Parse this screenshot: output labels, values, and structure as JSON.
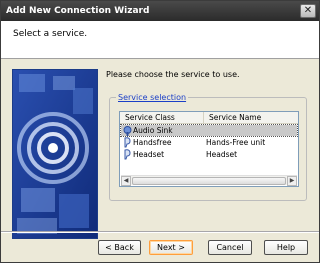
{
  "window": {
    "title": "Add New Connection Wizard"
  },
  "header": {
    "title": "Select a service."
  },
  "body": {
    "prompt": "Please choose the service to use."
  },
  "service_selection": {
    "label": "Service selection",
    "columns": [
      "Service Class",
      "Service Name"
    ],
    "rows": [
      {
        "class": "Audio Sink",
        "name": "",
        "selected": true
      },
      {
        "class": "Handsfree",
        "name": "Hands-Free unit",
        "selected": false
      },
      {
        "class": "Headset",
        "name": "Headset",
        "selected": false
      }
    ]
  },
  "buttons": {
    "back": "< Back",
    "next": "Next >",
    "cancel": "Cancel",
    "help": "Help"
  }
}
